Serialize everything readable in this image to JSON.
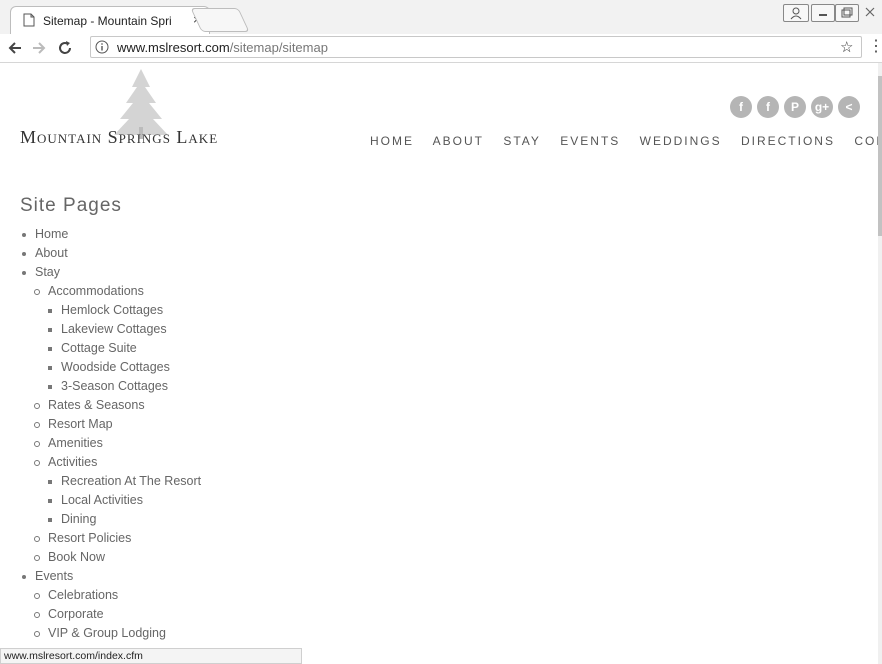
{
  "browser": {
    "tab_title": "Sitemap - Mountain Spri",
    "tab_close": "×",
    "url_host": "www.mslresort.com",
    "url_path": "/sitemap/sitemap",
    "status_url": "www.mslresort.com/index.cfm"
  },
  "site": {
    "logo_text": "Mountain Springs Lake",
    "nav": [
      "HOME",
      "ABOUT",
      "STAY",
      "EVENTS",
      "WEDDINGS",
      "DIRECTIONS",
      "CONTACT"
    ],
    "social": [
      {
        "icon": "facebook-icon",
        "glyph": "f"
      },
      {
        "icon": "facebook-icon",
        "glyph": "f"
      },
      {
        "icon": "pinterest-icon",
        "glyph": "P"
      },
      {
        "icon": "google-plus-icon",
        "glyph": "g+"
      },
      {
        "icon": "share-icon",
        "glyph": "<"
      }
    ]
  },
  "sitemap": {
    "title": "Site Pages",
    "items": [
      {
        "label": "Home",
        "level": 1
      },
      {
        "label": "About",
        "level": 1
      },
      {
        "label": "Stay",
        "level": 1
      },
      {
        "label": "Accommodations",
        "level": 2
      },
      {
        "label": "Hemlock Cottages",
        "level": 3
      },
      {
        "label": "Lakeview Cottages",
        "level": 3
      },
      {
        "label": "Cottage Suite",
        "level": 3
      },
      {
        "label": "Woodside Cottages",
        "level": 3
      },
      {
        "label": "3-Season Cottages",
        "level": 3
      },
      {
        "label": "Rates & Seasons",
        "level": 2
      },
      {
        "label": "Resort Map",
        "level": 2
      },
      {
        "label": "Amenities",
        "level": 2
      },
      {
        "label": "Activities",
        "level": 2
      },
      {
        "label": "Recreation At The Resort",
        "level": 3
      },
      {
        "label": "Local Activities",
        "level": 3
      },
      {
        "label": "Dining",
        "level": 3
      },
      {
        "label": "Resort Policies",
        "level": 2
      },
      {
        "label": "Book Now",
        "level": 2
      },
      {
        "label": "Events",
        "level": 1
      },
      {
        "label": "Celebrations",
        "level": 2
      },
      {
        "label": "Corporate",
        "level": 2
      },
      {
        "label": "VIP & Group Lodging",
        "level": 2
      }
    ]
  }
}
